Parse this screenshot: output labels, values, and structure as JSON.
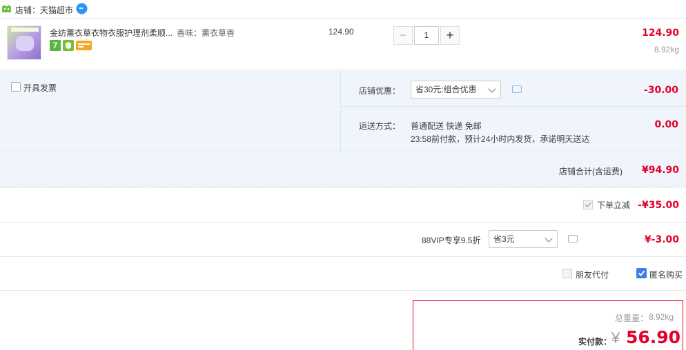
{
  "shop": {
    "prefix": "店铺：",
    "name": "天猫超市"
  },
  "item": {
    "title": "金纺薰衣草衣物衣服护理剂柔顺...",
    "sku": "香味：薰衣草香",
    "unit_price": "124.90",
    "quantity": "1",
    "subtotal": "124.90",
    "weight": "8.92kg",
    "badge_seven": "7"
  },
  "invoice": {
    "label": "开具发票"
  },
  "discount": {
    "label": "店铺优惠：",
    "selected": "省30元:组合优惠",
    "amount": "-30.00"
  },
  "shipping": {
    "label": "运送方式：",
    "line1": "普通配送 快递 免邮",
    "line2": "23:58前付款，预计24小时内发货，承诺明天送达",
    "amount": "0.00"
  },
  "shop_total": {
    "label": "店铺合计(含运费)",
    "amount": "¥94.90"
  },
  "instant": {
    "label": "下单立减",
    "amount": "-¥35.00"
  },
  "vip": {
    "label": "88VIP专享9.5折",
    "selected": "省3元",
    "amount": "¥-3.00"
  },
  "options": {
    "friend_pay": "朋友代付",
    "anonymous": "匿名购买"
  },
  "summary": {
    "weight_label": "总重量：",
    "weight": "8.92kg",
    "pay_label": "实付款：",
    "currency": "¥",
    "pay_amount": "56.90"
  },
  "colors": {
    "accent_red": "#e4002b",
    "blue_bg": "#f0f5fc",
    "checkbox_blue": "#3d7ee8"
  }
}
